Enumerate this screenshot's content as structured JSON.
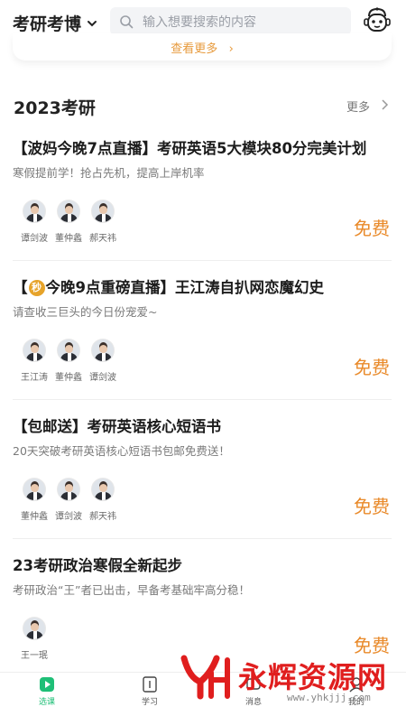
{
  "header": {
    "category_label": "考研考博",
    "search_placeholder": "输入想要搜索的内容"
  },
  "previous_card": {
    "more_label": "查看更多"
  },
  "section": {
    "title": "2023考研",
    "more_label": "更多"
  },
  "courses": [
    {
      "title": "【波妈今晚7点直播】考研英语5大模块80分完美计划",
      "desc": "寒假提前学！抢占先机，提高上岸机率",
      "teachers": [
        "谭剑波",
        "董仲蠡",
        "郝天祎"
      ],
      "price": "免费"
    },
    {
      "title_prefix": "【",
      "badge": "秒",
      "title": "今晚9点重磅直播】王江涛自扒网恋魔幻史",
      "desc": "请查收三巨头的今日份宠爱~",
      "teachers": [
        "王江涛",
        "董仲蠡",
        "谭剑波"
      ],
      "price": "免费"
    },
    {
      "title": "【包邮送】考研英语核心短语书",
      "desc": "20天突破考研英语核心短语书包邮免费送！",
      "teachers": [
        "董仲蠡",
        "谭剑波",
        "郝天祎"
      ],
      "price": "免费"
    },
    {
      "title": "23考研政治寒假全新起步",
      "desc": "考研政治“王”者已出击，早备考基础牢高分稳！",
      "teachers": [
        "王一珉"
      ],
      "price": "免费"
    }
  ],
  "tabbar": {
    "tabs": [
      {
        "label": "选课"
      },
      {
        "label": "学习"
      },
      {
        "label": "消息"
      },
      {
        "label": "我的"
      }
    ]
  },
  "watermark": {
    "text": "永辉资源网",
    "url": "www.yhkjjj.com"
  },
  "colors": {
    "accent": "#1fbf77",
    "price": "#e98a2a",
    "watermark": "#e01e1e"
  }
}
